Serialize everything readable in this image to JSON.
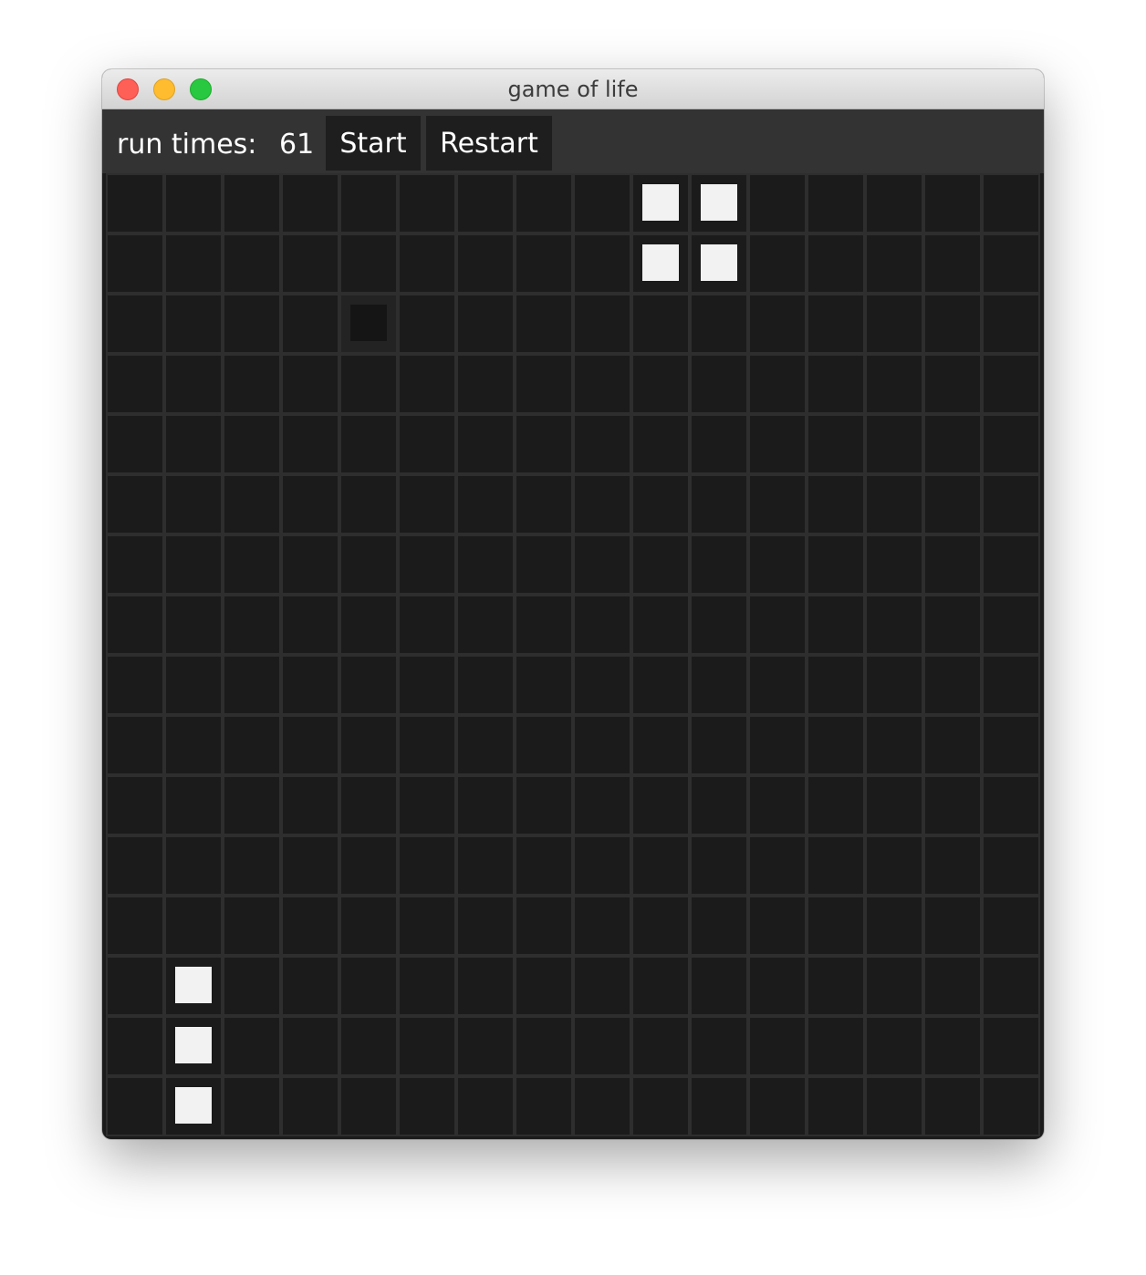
{
  "window": {
    "title": "game of life"
  },
  "toolbar": {
    "run_label": "run times:",
    "run_value": "61",
    "start_label": "Start",
    "restart_label": "Restart"
  },
  "board": {
    "cols": 16,
    "rows": 16,
    "alive": [
      [
        0,
        9
      ],
      [
        0,
        10
      ],
      [
        1,
        9
      ],
      [
        1,
        10
      ],
      [
        13,
        1
      ],
      [
        14,
        1
      ],
      [
        15,
        1
      ]
    ],
    "hover": [
      [
        2,
        4
      ]
    ]
  },
  "colors": {
    "background": "#1b1b1b",
    "grid_line": "#2e2e2e",
    "alive": "#f2f2f2",
    "toolbar": "#333333"
  }
}
